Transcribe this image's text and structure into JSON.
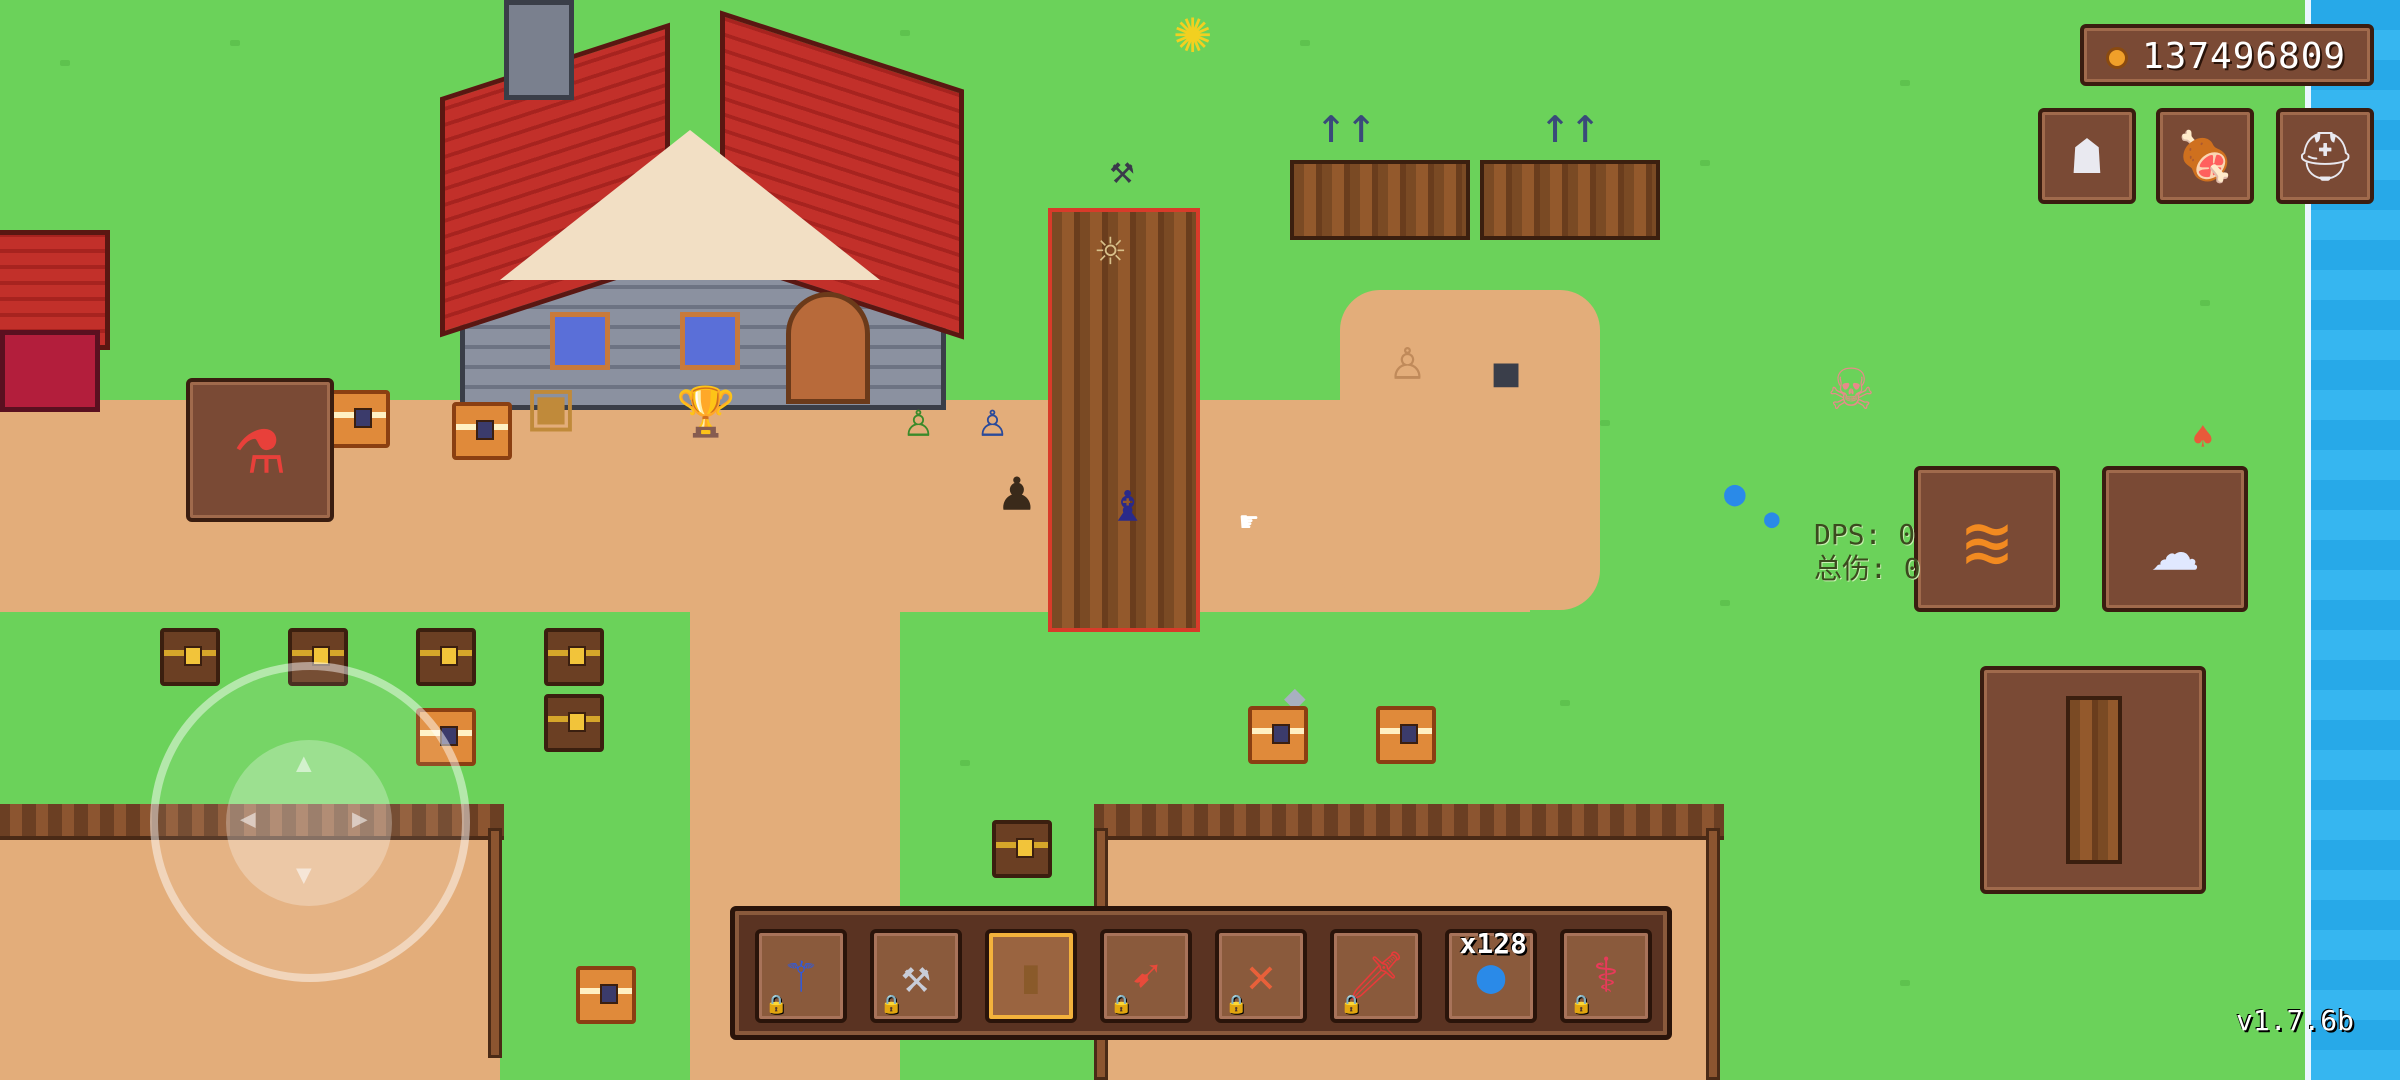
{
  "currency": {
    "icon": "coin-icon",
    "amount": "137496809"
  },
  "top_buttons": [
    {
      "icon": "ghost-icon",
      "glyph": "☗"
    },
    {
      "icon": "meat-icon",
      "glyph": "🍖"
    },
    {
      "icon": "helmet-icon",
      "glyph": "⛑"
    }
  ],
  "left_item": {
    "icon": "health-potion-icon",
    "glyph": "⚗"
  },
  "skills": [
    {
      "icon": "fire-claw-icon",
      "glyph": "≋"
    },
    {
      "icon": "spirit-dash-icon",
      "glyph": "☁"
    }
  ],
  "target_slot": {
    "icon": "wooden-log-icon"
  },
  "dps": {
    "label": "DPS: 0",
    "damage": "总伤: 0"
  },
  "hotbar": [
    {
      "icon": "staff-icon",
      "glyph": "⚚",
      "locked": true,
      "selected": false,
      "count": ""
    },
    {
      "icon": "axe-icon",
      "glyph": "⚒",
      "locked": true,
      "selected": false,
      "count": ""
    },
    {
      "icon": "wooden-plank-icon",
      "glyph": "▮",
      "locked": false,
      "selected": true,
      "count": ""
    },
    {
      "icon": "crossbow-icon",
      "glyph": "➹",
      "locked": true,
      "selected": false,
      "count": ""
    },
    {
      "icon": "double-crossbow-icon",
      "glyph": "✕",
      "locked": true,
      "selected": false,
      "count": ""
    },
    {
      "icon": "red-sword-icon",
      "glyph": "🗡",
      "locked": true,
      "selected": false,
      "count": ""
    },
    {
      "icon": "blue-orb-icon",
      "glyph": "●",
      "locked": false,
      "selected": false,
      "count": "x128"
    },
    {
      "icon": "red-wand-icon",
      "glyph": "⚕",
      "locked": true,
      "selected": false,
      "count": ""
    }
  ],
  "lock_glyph": "🔒",
  "version": "v1.7.6b",
  "colors": {
    "grass": "#6bd25a",
    "dirt": "#e3ad7a",
    "sea": "#27a9e8",
    "panel": "#7a4a35",
    "accent": "#f3b23c"
  }
}
